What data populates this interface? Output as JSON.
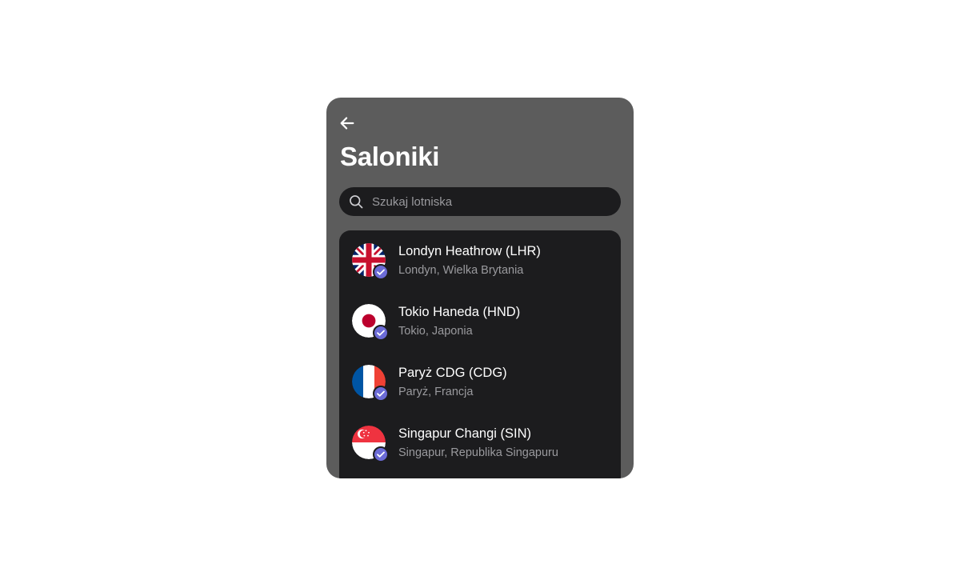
{
  "header": {
    "back_icon": "arrow-left-icon",
    "title": "Saloniki"
  },
  "search": {
    "icon": "search-icon",
    "placeholder": "Szukaj lotniska",
    "value": ""
  },
  "airports": [
    {
      "name": "Londyn Heathrow (LHR)",
      "location": "Londyn, Wielka Brytania",
      "flag": "uk-flag-icon",
      "verified": true
    },
    {
      "name": "Tokio Haneda (HND)",
      "location": "Tokio, Japonia",
      "flag": "japan-flag-icon",
      "verified": true
    },
    {
      "name": "Paryż CDG (CDG)",
      "location": "Paryż, Francja",
      "flag": "france-flag-icon",
      "verified": true
    },
    {
      "name": "Singapur Changi (SIN)",
      "location": "Singapur, Republika Singapuru",
      "flag": "singapore-flag-icon",
      "verified": true
    }
  ],
  "colors": {
    "card_background": "#5c5c5c",
    "panel_background": "#1c1c1e",
    "primary_text": "#ffffff",
    "secondary_text": "#9a9a9e",
    "verified_badge": "#6b6bd6"
  }
}
